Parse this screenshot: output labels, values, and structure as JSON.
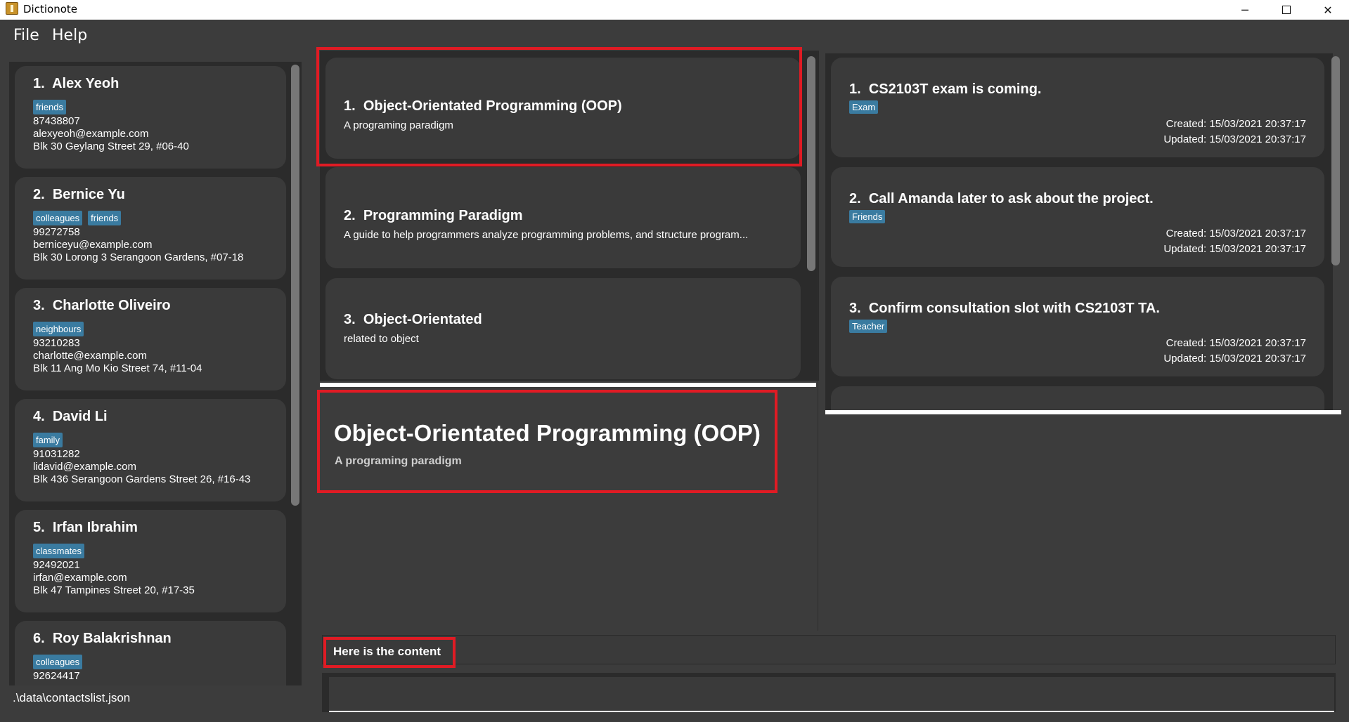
{
  "window": {
    "title": "Dictionote",
    "minimize": "─",
    "close": "✕"
  },
  "menu": {
    "file": "File",
    "help": "Help"
  },
  "contacts": [
    {
      "index": "1.",
      "name": "Alex Yeoh",
      "tags": [
        "friends"
      ],
      "phone": "87438807",
      "email": "alexyeoh@example.com",
      "address": "Blk 30 Geylang Street 29, #06-40"
    },
    {
      "index": "2.",
      "name": "Bernice Yu",
      "tags": [
        "colleagues",
        "friends"
      ],
      "phone": "99272758",
      "email": "berniceyu@example.com",
      "address": "Blk 30 Lorong 3 Serangoon Gardens, #07-18"
    },
    {
      "index": "3.",
      "name": "Charlotte Oliveiro",
      "tags": [
        "neighbours"
      ],
      "phone": "93210283",
      "email": "charlotte@example.com",
      "address": "Blk 11 Ang Mo Kio Street 74, #11-04"
    },
    {
      "index": "4.",
      "name": "David Li",
      "tags": [
        "family"
      ],
      "phone": "91031282",
      "email": "lidavid@example.com",
      "address": "Blk 436 Serangoon Gardens Street 26, #16-43"
    },
    {
      "index": "5.",
      "name": "Irfan Ibrahim",
      "tags": [
        "classmates"
      ],
      "phone": "92492021",
      "email": "irfan@example.com",
      "address": "Blk 47 Tampines Street 20, #17-35"
    },
    {
      "index": "6.",
      "name": "Roy Balakrishnan",
      "tags": [
        "colleagues"
      ],
      "phone": "92624417"
    }
  ],
  "status": {
    "path": ".\\data\\contactslist.json"
  },
  "entries": [
    {
      "index": "1.",
      "title": "Object-Orientated Programming (OOP)",
      "description": "A programing paradigm"
    },
    {
      "index": "2.",
      "title": "Programming Paradigm",
      "description": "A guide to help programmers analyze programming problems, and structure program..."
    },
    {
      "index": "3.",
      "title": "Object-Orientated",
      "description": "related to object"
    }
  ],
  "detail": {
    "title": "Object-Orientated Programming (OOP)",
    "description": "A programing paradigm"
  },
  "notes": [
    {
      "index": "1.",
      "title": "CS2103T exam is coming.",
      "tag": "Exam",
      "created": "Created: 15/03/2021 20:37:17",
      "updated": "Updated: 15/03/2021 20:37:17"
    },
    {
      "index": "2.",
      "title": "Call Amanda later to ask about the project.",
      "tag": "Friends",
      "created": "Created: 15/03/2021 20:37:17",
      "updated": "Updated: 15/03/2021 20:37:17"
    },
    {
      "index": "3.",
      "title": "Confirm consultation slot with CS2103T TA.",
      "tag": "Teacher",
      "created": "Created: 15/03/2021 20:37:17",
      "updated": "Updated: 15/03/2021 20:37:17"
    }
  ],
  "result": {
    "text": "Here is the content"
  },
  "command": {
    "value": ""
  },
  "colors": {
    "highlight": "#e01b24",
    "tag": "#3a7ba0",
    "card": "#3a3a3a",
    "panel": "#2b2b2b",
    "background": "#3c3c3c"
  }
}
